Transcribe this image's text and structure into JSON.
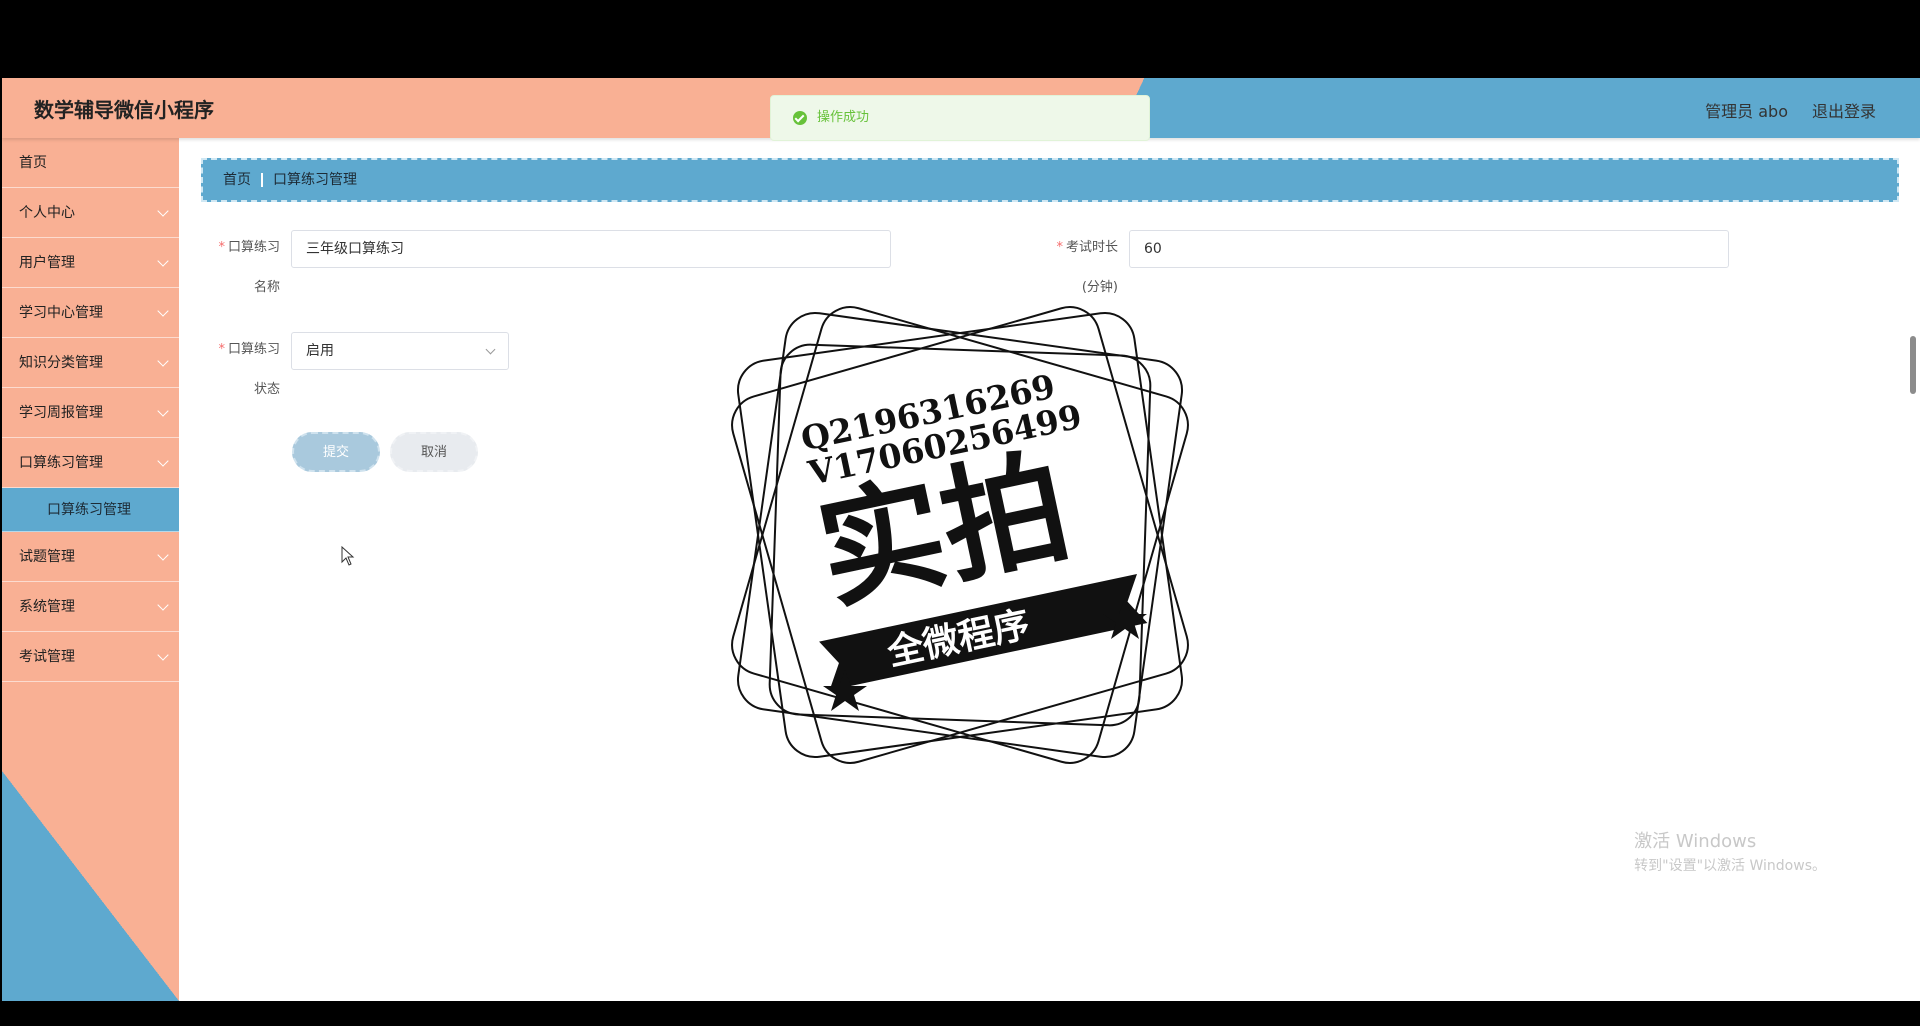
{
  "header": {
    "app_title": "数学辅导微信小程序",
    "admin_label": "管理员 abo",
    "logout_label": "退出登录",
    "colors": {
      "salmon": "#f9b094",
      "blue": "#5ea9cf"
    }
  },
  "toast": {
    "message": "操作成功",
    "color": "#67c23a",
    "icon": "success-check-icon"
  },
  "sidebar": {
    "items": [
      {
        "label": "首页",
        "expandable": false
      },
      {
        "label": "个人中心",
        "expandable": true
      },
      {
        "label": "用户管理",
        "expandable": true
      },
      {
        "label": "学习中心管理",
        "expandable": true
      },
      {
        "label": "知识分类管理",
        "expandable": true
      },
      {
        "label": "学习周报管理",
        "expandable": true
      },
      {
        "label": "口算练习管理",
        "expandable": true
      },
      {
        "label": "口算练习管理",
        "sub": true,
        "active": true
      },
      {
        "label": "试题管理",
        "expandable": true
      },
      {
        "label": "系统管理",
        "expandable": true
      },
      {
        "label": "考试管理",
        "expandable": true
      }
    ]
  },
  "breadcrumb": {
    "home": "首页",
    "current": "口算练习管理"
  },
  "form": {
    "name_label_1": "口算练习",
    "name_label_2": "名称",
    "name_value": "三年级口算练习",
    "duration_label_1": "考试时长",
    "duration_label_2": "(分钟)",
    "duration_value": "60",
    "status_label_1": "口算练习",
    "status_label_2": "状态",
    "status_value": "启用",
    "submit_label": "提交",
    "cancel_label": "取消"
  },
  "stamp": {
    "line1": "Q2196316269",
    "line2": "V17060256499",
    "big_text": "实拍",
    "ribbon_text": "全微程序"
  },
  "windows_watermark": {
    "line1": "激活 Windows",
    "line2": "转到\"设置\"以激活 Windows。"
  }
}
